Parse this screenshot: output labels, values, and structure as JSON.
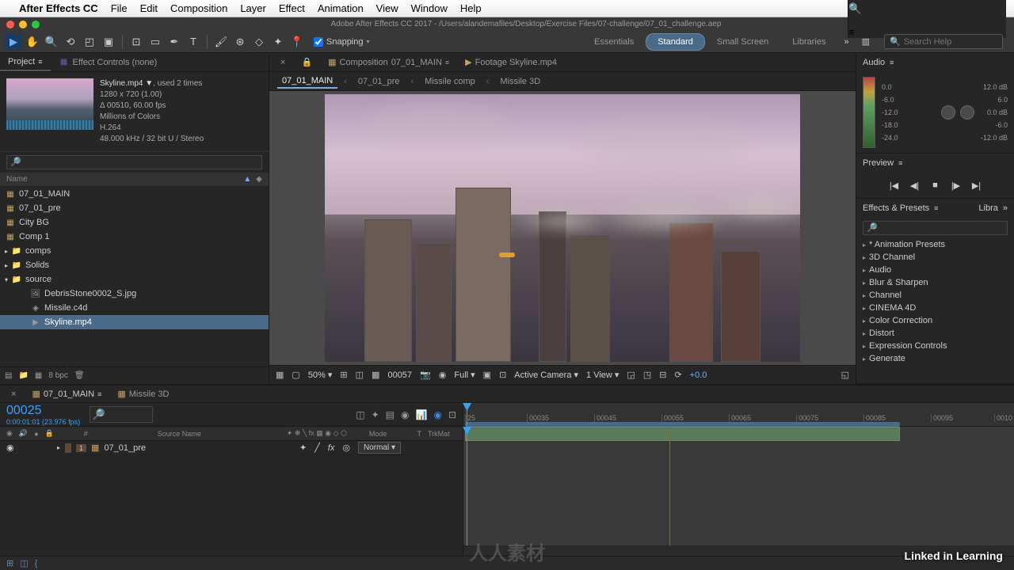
{
  "mac_menu": {
    "app": "After Effects CC",
    "items": [
      "File",
      "Edit",
      "Composition",
      "Layer",
      "Effect",
      "Animation",
      "View",
      "Window",
      "Help"
    ]
  },
  "title": "Adobe After Effects CC 2017 - /Users/alandemafiles/Desktop/Exercise Files/07-challenge/07_01_challenge.aep",
  "toolbar": {
    "snapping": "Snapping"
  },
  "workspaces": [
    "Essentials",
    "Standard",
    "Small Screen",
    "Libraries"
  ],
  "workspace_active": "Standard",
  "search_placeholder": "Search Help",
  "project": {
    "tab": "Project",
    "effect_tab": "Effect Controls (none)",
    "file": {
      "name": "Skyline.mp4 ▼",
      "used": ", used 2 times",
      "dims": "1280 x 720 (1.00)",
      "delta": "Δ 00510, 60.00 fps",
      "colors": "Millions of Colors",
      "codec": "H.264",
      "audio": "48.000 kHz / 32 bit U / Stereo"
    },
    "col_name": "Name",
    "items": [
      "07_01_MAIN",
      "07_01_pre",
      "City BG",
      "Comp 1",
      "comps",
      "Solids",
      "source",
      "DebrisStone0002_S.jpg",
      "Missile.c4d",
      "Skyline.mp4"
    ],
    "bpc": "8 bpc"
  },
  "comp": {
    "tabs": {
      "main": "Composition",
      "main_name": "07_01_MAIN",
      "footage": "Footage Skyline.mp4"
    },
    "breadcrumb": [
      "07_01_MAIN",
      "07_01_pre",
      "Missile comp",
      "Missile 3D"
    ]
  },
  "viewer": {
    "zoom": "50%",
    "frame": "00057",
    "res": "Full",
    "cam": "Active Camera",
    "views": "1 View",
    "exp": "+0.0"
  },
  "audio": {
    "title": "Audio",
    "left": [
      "0.0",
      "-6.0",
      "-12.0",
      "-18.0",
      "-24.0"
    ],
    "right": [
      "12.0 dB",
      "6.0",
      "0.0 dB",
      "-6.0",
      "-12.0 dB"
    ]
  },
  "preview": {
    "title": "Preview"
  },
  "fx": {
    "title": "Effects & Presets",
    "tab2": "Libra",
    "items": [
      "* Animation Presets",
      "3D Channel",
      "Audio",
      "Blur & Sharpen",
      "Channel",
      "CINEMA 4D",
      "Color Correction",
      "Distort",
      "Expression Controls",
      "Generate"
    ]
  },
  "timeline": {
    "tabs": [
      "07_01_MAIN",
      "Missile 3D"
    ],
    "timecode": "00025",
    "timecode_sub": "0:00:01:01 (23.976 fps)",
    "cols": {
      "source": "Source Name",
      "mode": "Mode",
      "t": "T",
      "trk": "TrkMat"
    },
    "layer": {
      "num": "1",
      "name": "07_01_pre",
      "mode": "Normal"
    },
    "ticks": [
      "25",
      "00035",
      "00045",
      "00055",
      "00065",
      "00075",
      "00085",
      "00095",
      "0010"
    ]
  },
  "watermark": "Linked in Learning",
  "watermark2": "人人素材"
}
